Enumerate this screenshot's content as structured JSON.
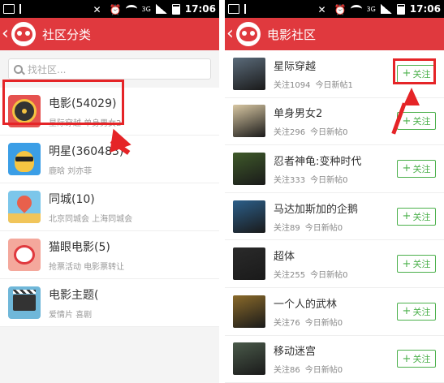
{
  "left": {
    "status": {
      "time": "17:06",
      "net": "3G"
    },
    "title": "社区分类",
    "search_placeholder": "找社区...",
    "categories": [
      {
        "name": "电影(54029)",
        "sub": "星际穿越  单身男女2",
        "icon": "film-reel-icon"
      },
      {
        "name": "明星(360483)",
        "sub": "鹿晗  刘亦菲",
        "icon": "star-face-icon"
      },
      {
        "name": "同城(10)",
        "sub": "北京同城会  上海同城会",
        "icon": "city-pin-icon"
      },
      {
        "name": "猫眼电影(5)",
        "sub": "抢票活动  电影票转让",
        "icon": "maoyan-icon"
      },
      {
        "name": "电影主题(",
        "sub": "爱情片  喜剧",
        "icon": "clapperboard-icon"
      }
    ]
  },
  "right": {
    "status": {
      "time": "17:06",
      "net": "3G"
    },
    "title": "电影社区",
    "follow_label": "关注",
    "movies": [
      {
        "name": "星际穿越",
        "followers": "关注1094",
        "today": "今日新帖1",
        "poster_color": "#5b6b7a"
      },
      {
        "name": "单身男女2",
        "followers": "关注296",
        "today": "今日新帖0",
        "poster_color": "#d8c7a2"
      },
      {
        "name": "忍者神龟:变种时代",
        "followers": "关注333",
        "today": "今日新帖0",
        "poster_color": "#3f5a2a"
      },
      {
        "name": "马达加斯加的企鹅",
        "followers": "关注89",
        "today": "今日新帖0",
        "poster_color": "#2c5f8a"
      },
      {
        "name": "超体",
        "followers": "关注255",
        "today": "今日新帖0",
        "poster_color": "#2a2a2a"
      },
      {
        "name": "一个人的武林",
        "followers": "关注76",
        "today": "今日新帖0",
        "poster_color": "#8a6a2a"
      },
      {
        "name": "移动迷宫",
        "followers": "关注86",
        "today": "今日新帖0",
        "poster_color": "#4a5a4a"
      }
    ]
  },
  "colors": {
    "brand": "#e0393e",
    "follow": "#4bb04b",
    "annotation": "#e52427"
  }
}
